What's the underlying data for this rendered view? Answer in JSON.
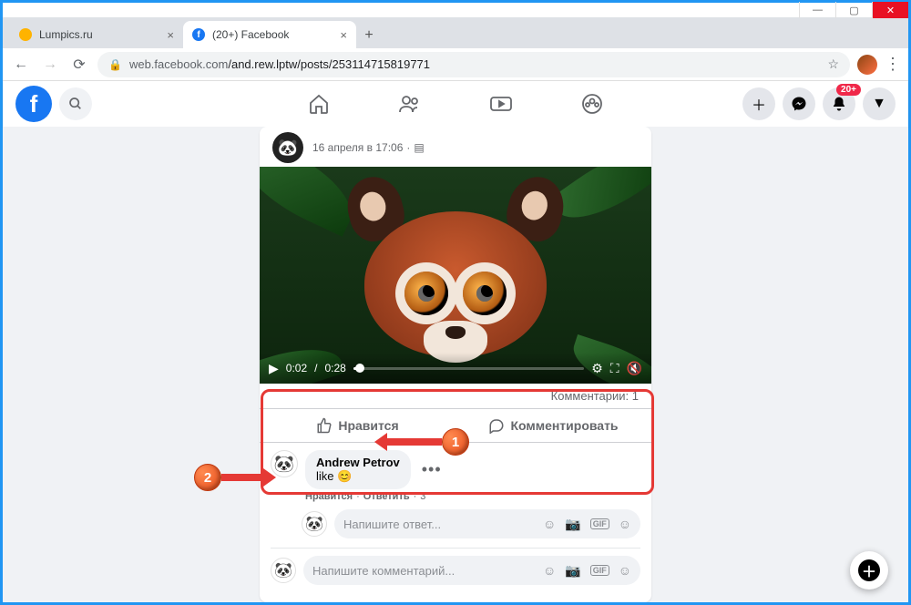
{
  "window": {
    "min": "—",
    "max": "▢",
    "close": "✕"
  },
  "tabs": {
    "inactive": {
      "title": "Lumpics.ru"
    },
    "active": {
      "title": "(20+) Facebook"
    }
  },
  "address": {
    "domain": "web.facebook.com",
    "path": "/and.rew.lptw/posts/253114715819771"
  },
  "fbheader": {
    "badge": "20+"
  },
  "post": {
    "date": "16 апреля в 17:06",
    "privacy_icon": "▤"
  },
  "video": {
    "current": "0:02",
    "duration": "0:28"
  },
  "stats": {
    "comments_label": "Комментарии: 1"
  },
  "actions": {
    "like": "Нравится",
    "comment": "Комментировать"
  },
  "comment": {
    "author": "Andrew Petrov",
    "text": "like 😊",
    "like": "Нравится",
    "reply": "Ответить",
    "time": "3"
  },
  "inputs": {
    "reply_placeholder": "Напишите ответ...",
    "comment_placeholder": "Напишите комментарий..."
  },
  "markers": {
    "m1": "1",
    "m2": "2"
  },
  "icon_text": {
    "gif": "GIF"
  }
}
